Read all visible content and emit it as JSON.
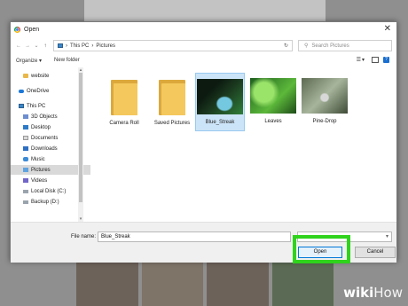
{
  "dialog": {
    "title": "Open"
  },
  "nav": {
    "back": "←",
    "forward": "→",
    "recent": "⌄",
    "up": "↑",
    "path": [
      "This PC",
      "Pictures"
    ],
    "separator": "›",
    "refresh": "↻",
    "search_placeholder": "Search Pictures"
  },
  "toolbar": {
    "organize": "Organize ▾",
    "new_folder": "New folder",
    "help": "?"
  },
  "sidebar": {
    "items": [
      {
        "label": "website",
        "icon": "folder-icon"
      },
      {
        "label": "OneDrive",
        "icon": "cloud-icon"
      },
      {
        "label": "This PC",
        "icon": "computer-icon"
      },
      {
        "label": "3D Objects",
        "icon": "3d-objects-icon"
      },
      {
        "label": "Desktop",
        "icon": "desktop-icon"
      },
      {
        "label": "Documents",
        "icon": "documents-icon"
      },
      {
        "label": "Downloads",
        "icon": "downloads-icon"
      },
      {
        "label": "Music",
        "icon": "music-icon"
      },
      {
        "label": "Pictures",
        "icon": "pictures-icon",
        "selected": true
      },
      {
        "label": "Videos",
        "icon": "videos-icon"
      },
      {
        "label": "Local Disk (C:)",
        "icon": "disk-icon"
      },
      {
        "label": "Backup (D:)",
        "icon": "disk-icon"
      }
    ]
  },
  "files": [
    {
      "name": "Camera Roll",
      "type": "folder"
    },
    {
      "name": "Saved Pictures",
      "type": "folder"
    },
    {
      "name": "Blue_Streak",
      "type": "image",
      "selected": true
    },
    {
      "name": "Leaves",
      "type": "image"
    },
    {
      "name": "Pine-Drop",
      "type": "image"
    }
  ],
  "bottom": {
    "file_name_label": "File name:",
    "file_name_value": "Blue_Streak",
    "open_label": "Open",
    "cancel_label": "Cancel"
  },
  "watermark": {
    "wiki": "wiki",
    "how": "How"
  },
  "colors": {
    "highlight": "#2fd31c",
    "selection": "#cce4f7",
    "accent": "#0078d7"
  }
}
